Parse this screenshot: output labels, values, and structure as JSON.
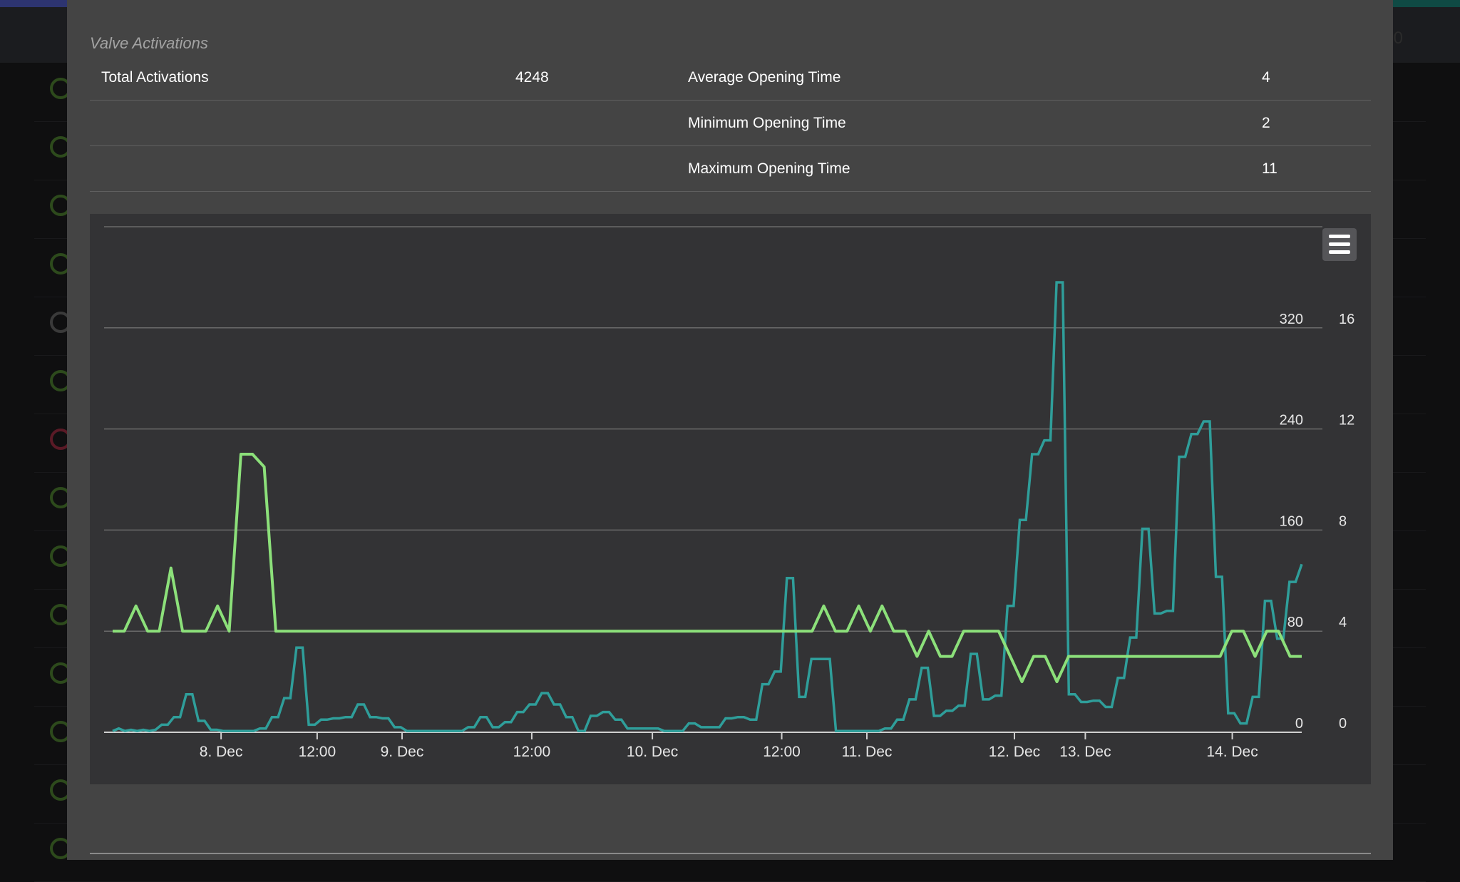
{
  "background": {
    "list_icons": [
      "green",
      "green",
      "green",
      "green",
      "grey",
      "green",
      "red",
      "green",
      "green",
      "green",
      "green",
      "green",
      "green",
      "green"
    ],
    "right_number": "0"
  },
  "modal": {
    "section_title": "Valve Activations",
    "stats": [
      {
        "left_label": "Total Activations",
        "left_value": "4248",
        "right_label": "Average Opening Time",
        "right_value": "4"
      },
      {
        "left_label": "",
        "left_value": "",
        "right_label": "Minimum Opening Time",
        "right_value": "2"
      },
      {
        "left_label": "",
        "left_value": "",
        "right_label": "Maximum Opening Time",
        "right_value": "11"
      }
    ],
    "chart_menu_icon": "hamburger-menu-icon"
  },
  "chart_data": {
    "type": "line",
    "title": "",
    "x_ticks": [
      "8. Dec",
      "12:00",
      "9. Dec",
      "12:00",
      "10. Dec",
      "12:00",
      "11. Dec",
      "12. Dec",
      "13. Dec",
      "14. Dec"
    ],
    "y_left": {
      "ticks": [
        "0",
        "80",
        "160",
        "240",
        "320"
      ],
      "range": [
        0,
        400
      ]
    },
    "y_right": {
      "ticks": [
        "0",
        "4",
        "8",
        "12",
        "16"
      ],
      "range": [
        0,
        20
      ]
    },
    "grid": true,
    "colors": {
      "activations": "#2f9e9a",
      "opening_time": "#8ce07a",
      "background": "#333335"
    },
    "series": [
      {
        "axis": "left",
        "step": true,
        "values": [
          1,
          3,
          1,
          2,
          1,
          2,
          1,
          2,
          6,
          6,
          12,
          12,
          30,
          30,
          9,
          9,
          2,
          2,
          1,
          1,
          1,
          1,
          1,
          1,
          3,
          3,
          12,
          12,
          27,
          27,
          67,
          67,
          6,
          6,
          10,
          10,
          11,
          11,
          12,
          12,
          22,
          22,
          12,
          12,
          11,
          11,
          4,
          4,
          1,
          1,
          1,
          1,
          1,
          1,
          1,
          1,
          1,
          1,
          4,
          4,
          12,
          12,
          4,
          4,
          8,
          8,
          16,
          16,
          22,
          22,
          31,
          31,
          22,
          22,
          12,
          12,
          1,
          1,
          13,
          13,
          16,
          16,
          10,
          10,
          3,
          3,
          3,
          3,
          3,
          3,
          1,
          1,
          1,
          1,
          7,
          7,
          4,
          4,
          4,
          4,
          11,
          11,
          12,
          12,
          10,
          10,
          38,
          38,
          48,
          48,
          122,
          122,
          28,
          28,
          58,
          58,
          58,
          58,
          1,
          1,
          1,
          1,
          1,
          1,
          1,
          1,
          3,
          3,
          10,
          10,
          26,
          26,
          51,
          51,
          13,
          13,
          17,
          17,
          21,
          21,
          62,
          62,
          26,
          26,
          29,
          29,
          100,
          100,
          168,
          168,
          220,
          220,
          231,
          231,
          356,
          356,
          30,
          30,
          24,
          24,
          25,
          25,
          20,
          20,
          43,
          43,
          75,
          75,
          161,
          161,
          94,
          94,
          96,
          96,
          218,
          218,
          236,
          236,
          246,
          246,
          123,
          123,
          15,
          15,
          7,
          7,
          28,
          28,
          104,
          104,
          74,
          74,
          119,
          119,
          133
        ]
      },
      {
        "axis": "right",
        "step": false,
        "values": [
          4,
          4,
          5,
          4,
          4,
          6.5,
          4,
          4,
          4,
          5,
          4,
          11,
          11,
          10.5,
          4,
          4,
          4,
          4,
          4,
          4,
          4,
          4,
          4,
          4,
          4,
          4,
          4,
          4,
          4,
          4,
          4,
          4,
          4,
          4,
          4,
          4,
          4,
          4,
          4,
          4,
          4,
          4,
          4,
          4,
          4,
          4,
          4,
          4,
          4,
          4,
          4,
          4,
          4,
          4,
          4,
          4,
          4,
          4,
          4,
          4,
          4,
          5,
          4,
          4,
          5,
          4,
          5,
          4,
          4,
          3,
          4,
          3,
          3,
          4,
          4,
          4,
          4,
          3,
          2,
          3,
          3,
          2,
          3,
          3,
          3,
          3,
          3,
          3,
          3,
          3,
          3,
          3,
          3,
          3,
          3,
          3,
          4,
          4,
          3,
          4,
          4,
          3,
          3
        ]
      }
    ]
  }
}
